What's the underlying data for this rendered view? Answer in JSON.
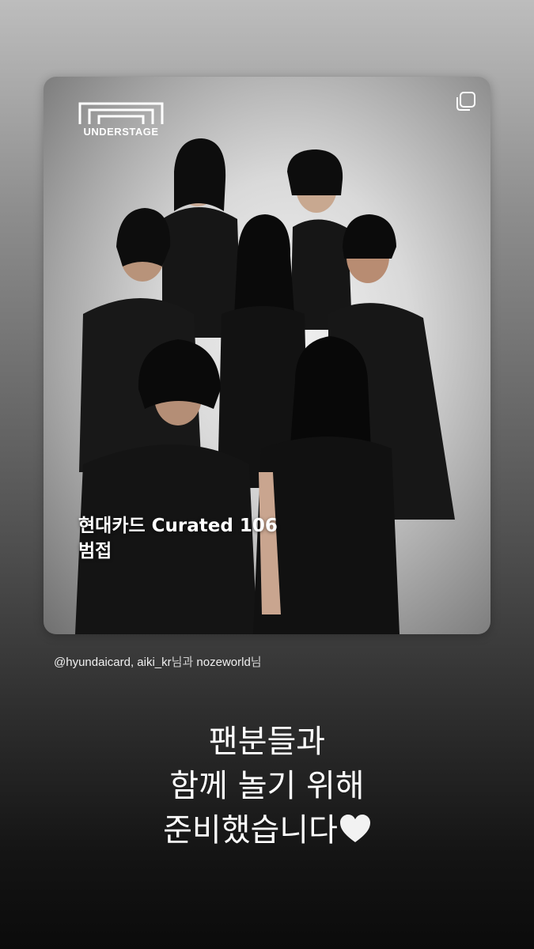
{
  "post": {
    "brand": "UNDERSTAGE",
    "title_line1": "현대카드 Curated 106",
    "title_line2": "범접",
    "multi_icon": "multi-image-icon"
  },
  "mentions": {
    "accounts": "@hyundaicard, aiki_kr",
    "joiner": "님과 ",
    "last": "nozeworld",
    "suffix": "님"
  },
  "caption": {
    "line1": "팬분들과",
    "line2": "함께 놀기 위해",
    "line3": "준비했습니다",
    "emoji": "white-heart-icon"
  },
  "colors": {
    "heart": "#f2f2f2",
    "outfit": "#141414"
  }
}
